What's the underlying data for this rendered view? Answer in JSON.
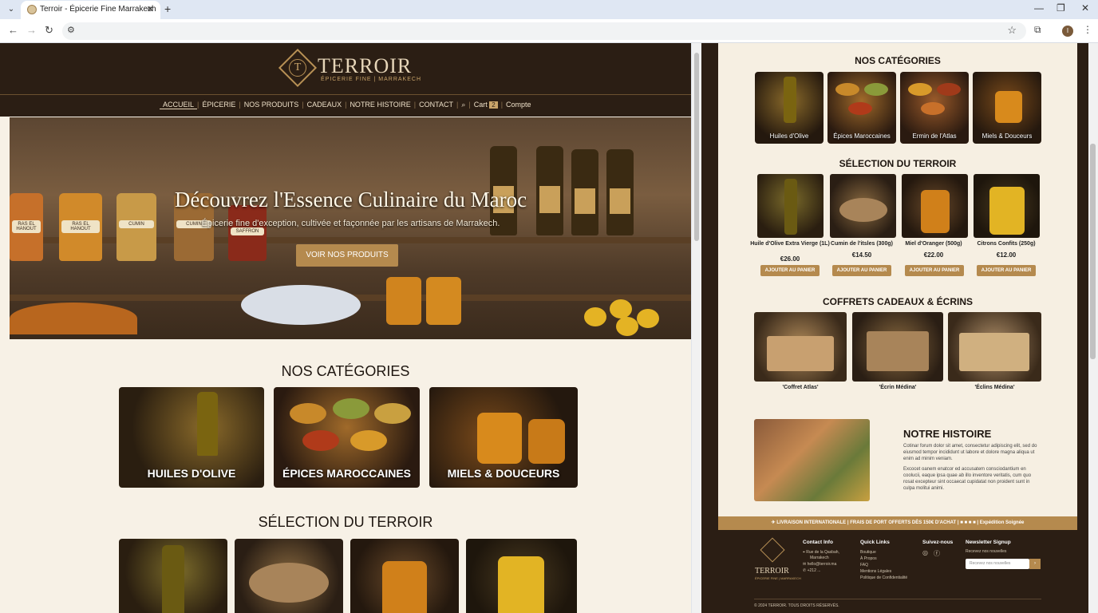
{
  "browser": {
    "tab_title": "Terroir - Épicerie Fine Marrakech",
    "tab_close": "✕",
    "new_tab": "+",
    "avatar_letter": "I"
  },
  "site": {
    "logo": "TERROIR",
    "logo_sub": "ÉPICERIE FINE | MARRAKECH",
    "nav": [
      "ACCUEIL",
      "ÉPICERIE",
      "NOS PRODUITS",
      "CADEAUX",
      "NOTRE HISTOIRE",
      "CONTACT"
    ],
    "cart_label": "Cart",
    "cart_count": "2",
    "account": "Compte"
  },
  "hero": {
    "title": "Découvrez l'Essence Culinaire du Maroc",
    "subtitle": "Épicerie fine d'exception, cultivée et façonnée par les artisans de Marrakech.",
    "button": "VOIR NOS PRODUITS",
    "jar_labels": [
      "RAS EL HANOUT",
      "RAS EL HANOUT",
      "CUMIN",
      "CUMIN",
      "SAFFRON"
    ]
  },
  "left": {
    "categories_title": "NOS CATÉGORIES",
    "categories": [
      "HUILES D'OLIVE",
      "ÉPICES MAROCCAINES",
      "MIELS & DOUCEURS"
    ],
    "selection_title": "SÉLECTION DU TERROIR"
  },
  "right": {
    "categories_title": "NOS CATÉGORIES",
    "categories": [
      "Huiles d'Olive",
      "Épices Maroccaines",
      "Ermin de l'Atlas",
      "Miels & Douceurs"
    ],
    "selection_title": "SÉLECTION DU TERROIR",
    "products": [
      {
        "name": "Huile d'Olive Extra Vierge (1L)",
        "price": "€26.00"
      },
      {
        "name": "Cumin de l'itsles (300g)",
        "price": "€14.50"
      },
      {
        "name": "Miel d'Oranger (500g)",
        "price": "€22.00"
      },
      {
        "name": "Citrons Confits (250g)",
        "price": "€12.00"
      }
    ],
    "add_to_cart": "AJOUTER AU PANIER",
    "gifts_title": "COFFRETS CADEAUX & ÉCRINS",
    "gifts": [
      "'Coffret Atlas'",
      "'Écrin Médina'",
      "'Éclins Médina'"
    ],
    "story_title": "NOTRE HISTOIRE",
    "story_p1": "Cotinar forum dolor sit amet, consectetur adipiscing elit, sed do eiusmod tempor incididunt ut labore et dolore magna aliqua ut enim ad minim veniam.",
    "story_p2": "Excocet oanem enatcor ed accusatem consciodantium en coolucii, eaque ipsa quae ab illo inventore veritatis, cum quo rosat excepteur sint occaecat cupidatat non proident sunt in culpa molitui animi.",
    "promo": "✈ LIVRAISON INTERNATIONALE | FRAIS DE PORT OFFERTS DÈS 150€ D'ACHAT | ■ ■ ■ ■ | Expédition Soignée",
    "footer": {
      "logo": "TERROIR",
      "logo_sub": "ÉPICERIE FINE | MARRAKECH",
      "contact_title": "Contact Info",
      "contact_lines": [
        "Rue de la Qasbah,",
        "Marrakech",
        "hello@terroir.ma",
        "+212 ..."
      ],
      "links_title": "Quick Links",
      "links": [
        "Boutique",
        "À Propos",
        "FAQ",
        "Mentions Légales",
        "Politique de Confidentialité"
      ],
      "follow_title": "Suivez-nous",
      "newsletter_title": "Newsletter Signup",
      "newsletter_text": "Recevez nos nouvelles",
      "newsletter_placeholder": "Recevez nos nouvelles",
      "copyright": "© 2024 TERROIR. TOUS DROITS RÉSERVÉS."
    }
  },
  "colors": {
    "dark_brown": "#2b1e14",
    "gold": "#b58a4e",
    "cream": "#f7f1e6"
  }
}
